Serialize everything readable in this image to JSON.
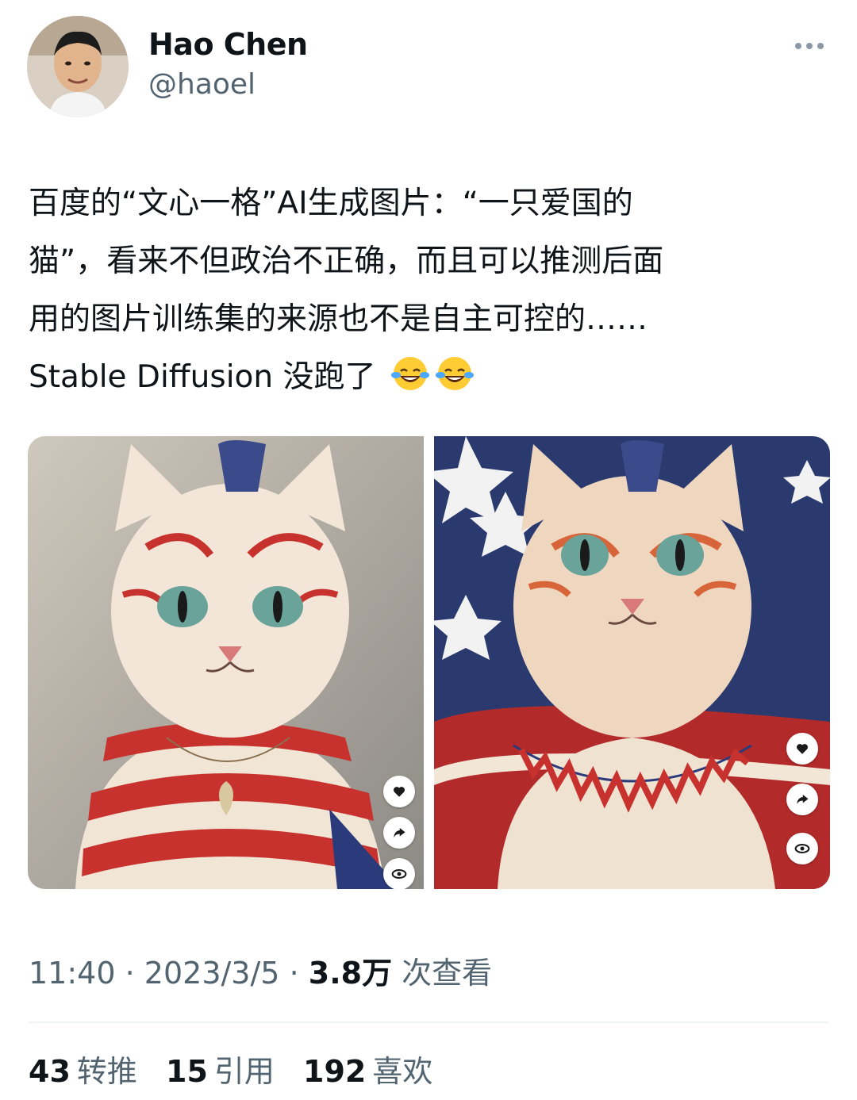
{
  "author": {
    "name": "Hao Chen",
    "handle": "@haoel"
  },
  "tweet": {
    "lines": [
      "百度的“文心一格”AI生成图片：“一只爱国的",
      "猫”，看来不但政治不正确，而且可以推测后面",
      "用的图片训练集的来源也不是自主可控的……",
      "Stable Diffusion 没跑了"
    ],
    "trailing_emoji": "face-with-tears-of-joy-icon"
  },
  "media": {
    "count": 2,
    "actions": [
      "heart-icon",
      "share-icon",
      "eye-icon"
    ]
  },
  "meta": {
    "time": "11:40",
    "separator": "·",
    "date": "2023/3/5",
    "views_count": "3.8万",
    "views_label": "次查看"
  },
  "stats": [
    {
      "count": "43",
      "label": "转推"
    },
    {
      "count": "15",
      "label": "引用"
    },
    {
      "count": "192",
      "label": "喜欢"
    }
  ],
  "colors": {
    "text_primary": "#0f1419",
    "text_secondary": "#536471",
    "divider": "#eff3f4"
  }
}
